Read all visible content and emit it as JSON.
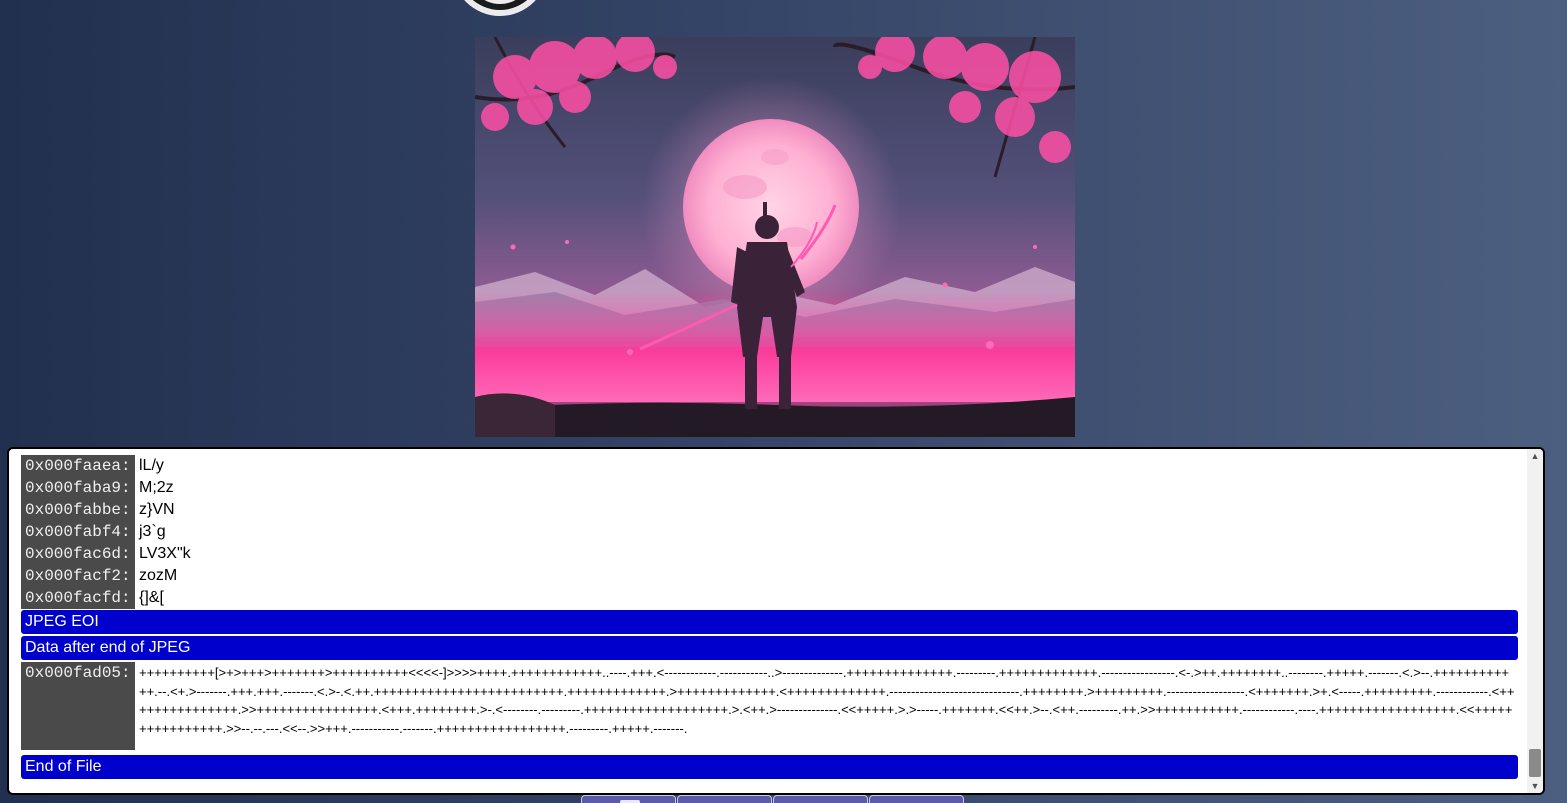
{
  "hex_viewer": {
    "rows": [
      {
        "address": "0x000faaea:",
        "value": "lL/y"
      },
      {
        "address": "0x000faba9:",
        "value": "M;2z"
      },
      {
        "address": "0x000fabbe:",
        "value": "z}VN"
      },
      {
        "address": "0x000fabf4:",
        "value": "j3`g"
      },
      {
        "address": "0x000fac6d:",
        "value": "LV3X\"k"
      },
      {
        "address": "0x000facf2:",
        "value": "zozM"
      },
      {
        "address": "0x000facfd:",
        "value": "{]&["
      }
    ],
    "banner_eoi": "JPEG EOI",
    "banner_after": "Data after end of JPEG",
    "trailing_row": {
      "address": "0x000fad05:",
      "value": "++++++++++[>+>+++>+++++++>++++++++++<<<<-]>>>>++++.++++++++++++..----.+++.<------------.-----------..>--------------.++++++++++++++.---------.+++++++++++++.-----------------.<-.>++.++++++++..--------.+++++.-------.<.>--.++++++++++++.--.<+.>-------.+++.+++.-------.<.>-.<.++.+++++++++++++++++++++++++.+++++++++++++.>+++++++++++++.<+++++++++++++.------------------------------.++++++++.>+++++++++.------------------.<+++++++.>+.<-----.+++++++++.------------.<+++++++++++++++.>>++++++++++++++++.<+++.++++++++.>-.<--------.---------.+++++++++++++++++++.>.<++.>--------------.<<+++++.>.>-----.+++++++.<<++.>--.<++.---------.++.>>+++++++++++.------------.----.++++++++++++++++++.<<++++++++++++++++.>>--.--.---.<<--.>>+++.-----------.-------.+++++++++++++++++.---------.+++++.-------."
    },
    "banner_end": "End of File"
  },
  "colors": {
    "banner": "#0000cc",
    "address_bg": "#4a4a4a"
  }
}
